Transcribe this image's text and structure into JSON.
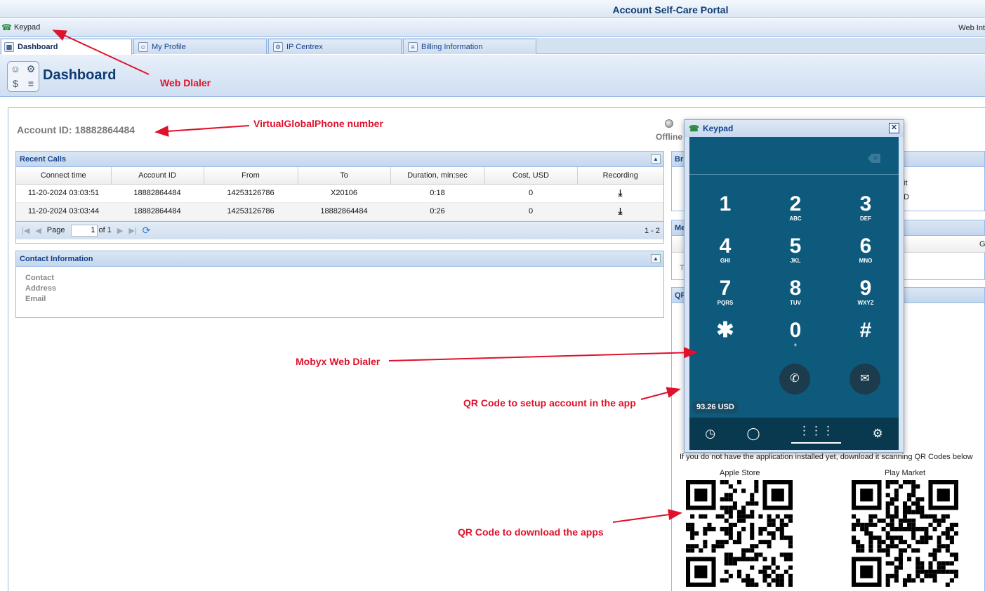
{
  "app": {
    "title": "Account Self-Care Portal",
    "keypad_link": "Keypad",
    "web_int": "Web Int"
  },
  "tabs": [
    {
      "label": "Dashboard",
      "active": true
    },
    {
      "label": "My Profile",
      "active": false
    },
    {
      "label": "IP Centrex",
      "active": false
    },
    {
      "label": "Billing Information",
      "active": false
    }
  ],
  "page": {
    "title": "Dashboard",
    "account_id": "Account ID: 18882864484",
    "status": "Offline"
  },
  "recent_calls": {
    "title": "Recent Calls",
    "columns": [
      "Connect time",
      "Account ID",
      "From",
      "To",
      "Duration, min:sec",
      "Cost, USD",
      "Recording"
    ],
    "rows": [
      [
        "11-20-2024 03:03:51",
        "18882864484",
        "14253126786",
        "X20106",
        "0:18",
        "0"
      ],
      [
        "11-20-2024 03:03:44",
        "18882864484",
        "14253126786",
        "18882864484",
        "0:26",
        "0"
      ]
    ],
    "pager": {
      "page_label": "Page",
      "page_value": "1",
      "of_label": "of 1",
      "range": "1 - 2"
    }
  },
  "contact": {
    "title": "Contact Information",
    "fields": [
      "Contact",
      "Address",
      "Email"
    ]
  },
  "side_panels": {
    "p1": "Br",
    "p1_text_a": "it",
    "p1_text_b": "D",
    "p2": "Me",
    "p2_col": "G",
    "p2_text": "T",
    "p3": "QF"
  },
  "qr": {
    "note": "If you do not have the application installed yet, download it scanning QR Codes below",
    "apple": "Apple Store",
    "play": "Play Market"
  },
  "keypad": {
    "title": "Keypad",
    "keys": [
      {
        "d": "1",
        "l": ""
      },
      {
        "d": "2",
        "l": "ABC"
      },
      {
        "d": "3",
        "l": "DEF"
      },
      {
        "d": "4",
        "l": "GHI"
      },
      {
        "d": "5",
        "l": "JKL"
      },
      {
        "d": "6",
        "l": "MNO"
      },
      {
        "d": "7",
        "l": "PQRS"
      },
      {
        "d": "8",
        "l": "TUV"
      },
      {
        "d": "9",
        "l": "WXYZ"
      },
      {
        "d": "✱",
        "l": ""
      },
      {
        "d": "0",
        "l": "+"
      },
      {
        "d": "#",
        "l": ""
      }
    ],
    "balance": "93.26 USD"
  },
  "annotations": {
    "web_dialer": "Web Dlaler",
    "vgp_number": "VirtualGlobalPhone number",
    "mobyx": "Mobyx Web Dialer",
    "qr_setup": "QR Code to setup account in the app",
    "qr_download": "QR Code to download the apps"
  },
  "colors": {
    "annotation": "#e0112b",
    "phone_bg": "#0e5a7d",
    "header_blue": "#15428b"
  }
}
